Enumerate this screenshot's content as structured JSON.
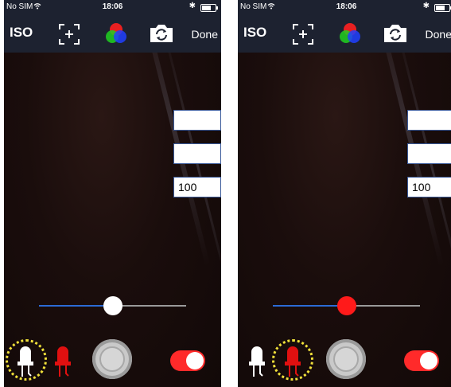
{
  "screens": [
    {
      "status": {
        "carrier": "No SIM",
        "time": "18:06",
        "bluetooth": "✱",
        "battery_level": 0.7
      },
      "toolbar": {
        "iso_label": "ISO",
        "done_label": "Done"
      },
      "fields": {
        "field_1": "",
        "field_2": "",
        "field_3": "100"
      },
      "slider": {
        "value": 0.5,
        "thumb_color": "#ffffff"
      },
      "selected_led": "white",
      "toggle": {
        "on": true
      }
    },
    {
      "status": {
        "carrier": "No SIM",
        "time": "18:06",
        "bluetooth": "✱",
        "battery_level": 0.7
      },
      "toolbar": {
        "iso_label": "ISO",
        "done_label": "Done"
      },
      "fields": {
        "field_1": "",
        "field_2": "",
        "field_3": "100"
      },
      "slider": {
        "value": 0.5,
        "thumb_color": "#ff1a1a"
      },
      "selected_led": "red",
      "toggle": {
        "on": true
      }
    }
  ],
  "colors": {
    "toolbar_bg": "#1d2230",
    "accent_blue": "#2b6bd6",
    "toggle_red": "#ff2a2a",
    "led_red": "#e01010",
    "selection_yellow": "#f0e03a"
  },
  "icons": [
    "focus-frame-icon",
    "rgb-color-icon",
    "switch-camera-icon",
    "white-led-icon",
    "red-led-icon",
    "shutter-icon",
    "bluetooth-icon",
    "wifi-icon",
    "battery-icon"
  ]
}
